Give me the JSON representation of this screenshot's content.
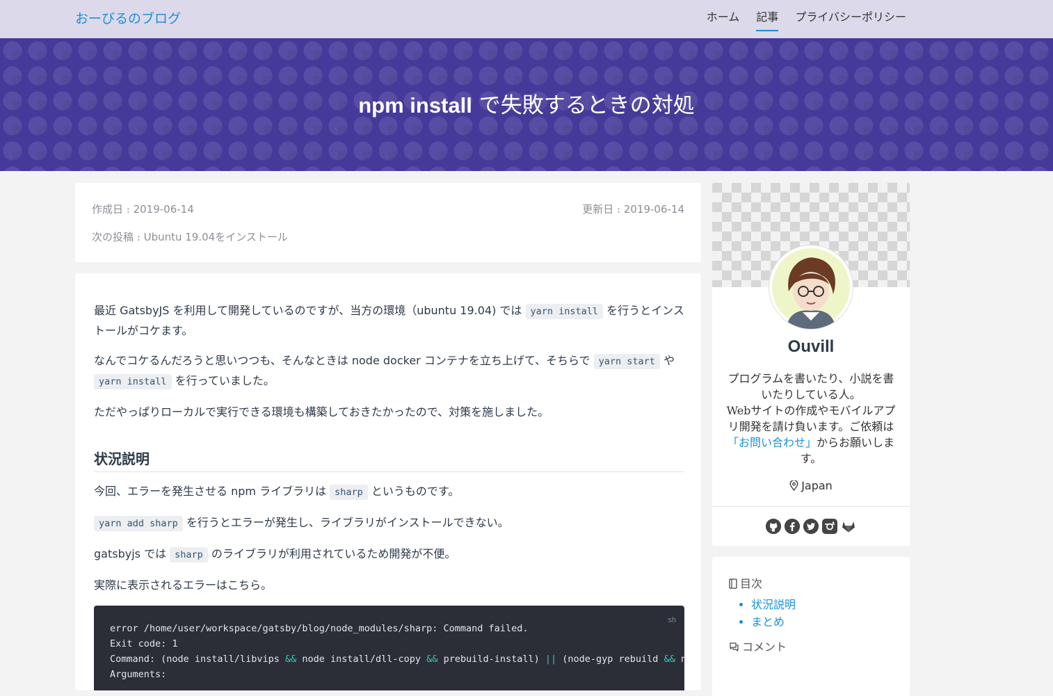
{
  "site": {
    "brand": "おーびるのブログ"
  },
  "nav": {
    "items": [
      "ホーム",
      "記事",
      "プライバシーポリシー"
    ],
    "active": "記事"
  },
  "hero": {
    "title_code": "npm install",
    "title_rest": " で失敗するときの対処"
  },
  "meta": {
    "created_label": "作成日 : ",
    "created_value": "2019-06-14",
    "updated_label": "更新日 : ",
    "updated_value": "2019-06-14",
    "next_label": "次の投稿 : ",
    "next_value_en": "Ubuntu 19.04",
    "next_value_jp": "をインストール"
  },
  "article": {
    "p1": {
      "a": "最近 ",
      "b": "GatsbyJS",
      "c": " を利用して開発しているのですが、当方の環境（",
      "d": "ubuntu 19.04)",
      "e": " では ",
      "code": "yarn install",
      "f": " を行うとインストールがコケます。"
    },
    "p2": {
      "a": "なんでコケるんだろうと思いつつも、そんなときは ",
      "b": "node docker",
      "c": " コンテナを立ち上げて、そちらで ",
      "code1": "yarn start",
      "d": " や ",
      "code2": "yarn install",
      "e": " を行っていました。"
    },
    "p3": "ただやっぱりローカルで実行できる環境も構築しておきたかったので、対策を施しました。",
    "section_heading": "状況説明",
    "p4": {
      "a": "今回、エラーを発生させる ",
      "b": "npm",
      "c": " ライブラリは ",
      "code": "sharp",
      "d": " というものです。"
    },
    "p5": {
      "code": "yarn add sharp",
      "a": " を行うとエラーが発生し、ライブラリがインストールできない。"
    },
    "p6": {
      "a": "gatsbyjs",
      "b": " では ",
      "code": "sharp",
      "c": " のライブラリが利用されているため開発が不便。"
    },
    "p7": "実際に表示されるエラーはこちら。",
    "codeblock": {
      "lang": "sh",
      "line1": "error /home/user/workspace/gatsby/blog/node_modules/sharp: Command failed.",
      "line2": "Exit code: 1",
      "line3_a": "Command: (node install/libvips ",
      "line3_op1": "&&",
      "line3_b": " node install/dll-copy ",
      "line3_op2": "&&",
      "line3_c": " prebuild-install) ",
      "line3_op3": "||",
      "line3_d": " (node-gyp rebuild ",
      "line3_op4": "&&",
      "line3_e": " node install/dll-copy)",
      "line4": "Arguments:"
    }
  },
  "profile": {
    "name": "Ouvill",
    "bio_1": "プログラムを書いたり、小説を書いたりしている人。",
    "bio_2": "Webサイトの作成やモバイルアプリ開発を請け負います。ご依頼は",
    "bio_link": "「お問い合わせ」",
    "bio_3": "からお願いします。",
    "location": "Japan",
    "socials": [
      "github-icon",
      "facebook-icon",
      "twitter-icon",
      "instagram-icon",
      "gitlab-icon"
    ]
  },
  "toc": {
    "title": "目次",
    "items": [
      "状況説明",
      "まとめ"
    ],
    "comment_title": "コメント"
  },
  "colors": {
    "accent": "#1a8fd8",
    "hero": "#45399a",
    "topbar": "#dcd9ea"
  }
}
